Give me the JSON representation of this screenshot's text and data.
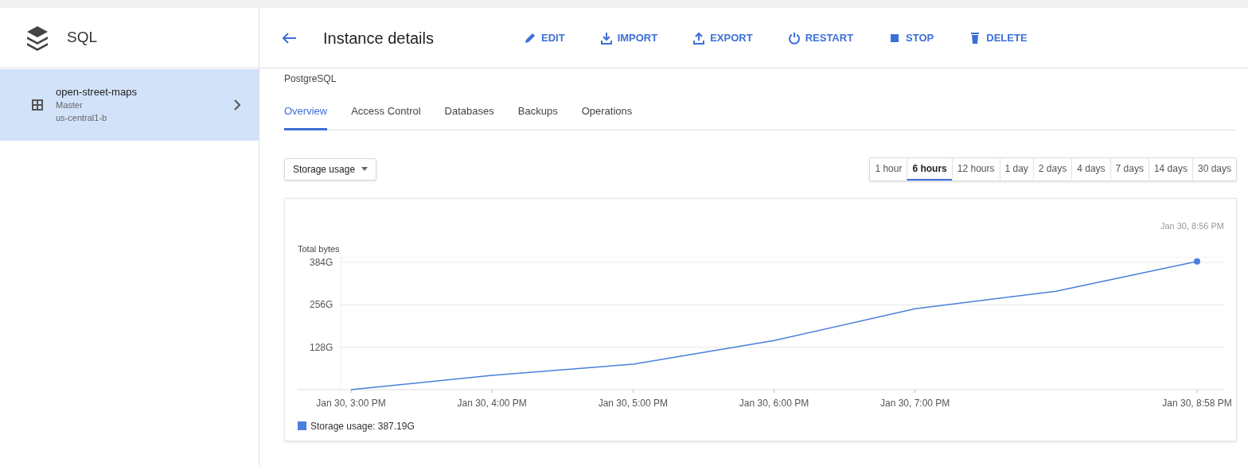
{
  "sidebar": {
    "product": "SQL",
    "items": [
      {
        "name": "open-street-maps",
        "role": "Master",
        "zone": "us-central1-b",
        "selected": true
      }
    ]
  },
  "header": {
    "title": "Instance details",
    "actions": [
      {
        "label": "EDIT",
        "kind": "edit"
      },
      {
        "label": "IMPORT",
        "kind": "import"
      },
      {
        "label": "EXPORT",
        "kind": "export"
      },
      {
        "label": "RESTART",
        "kind": "restart"
      },
      {
        "label": "STOP",
        "kind": "stop"
      },
      {
        "label": "DELETE",
        "kind": "delete"
      }
    ]
  },
  "engine": "PostgreSQL",
  "tabs": [
    {
      "label": "Overview",
      "selected": true
    },
    {
      "label": "Access Control",
      "selected": false
    },
    {
      "label": "Databases",
      "selected": false
    },
    {
      "label": "Backups",
      "selected": false
    },
    {
      "label": "Operations",
      "selected": false
    }
  ],
  "metric_select": "Storage usage",
  "ranges": [
    {
      "label": "1 hour",
      "selected": false
    },
    {
      "label": "6 hours",
      "selected": true
    },
    {
      "label": "12 hours",
      "selected": false
    },
    {
      "label": "1 day",
      "selected": false
    },
    {
      "label": "2 days",
      "selected": false
    },
    {
      "label": "4 days",
      "selected": false
    },
    {
      "label": "7 days",
      "selected": false
    },
    {
      "label": "14 days",
      "selected": false
    },
    {
      "label": "30 days",
      "selected": false
    }
  ],
  "chart": {
    "timestamp": "Jan 30, 8:56 PM",
    "legend_suffix": ": 387.19G",
    "chart_data": {
      "type": "line",
      "ylabel": "Total bytes",
      "categories": [
        "Jan 30, 3:00 PM",
        "Jan 30, 4:00 PM",
        "Jan 30, 5:00 PM",
        "Jan 30, 6:00 PM",
        "Jan 30, 7:00 PM",
        null,
        "Jan 30, 8:58 PM"
      ],
      "series": [
        {
          "name": "Storage usage",
          "color": "#4a7fdc",
          "values": [
            0,
            43,
            77,
            148,
            244,
            297,
            387
          ]
        }
      ],
      "grid": true,
      "ylim": [
        0,
        400
      ],
      "yticks": [
        {
          "value": 128,
          "label": "128G"
        },
        {
          "value": 256,
          "label": "256G"
        },
        {
          "value": 384,
          "label": "384G"
        }
      ]
    }
  }
}
